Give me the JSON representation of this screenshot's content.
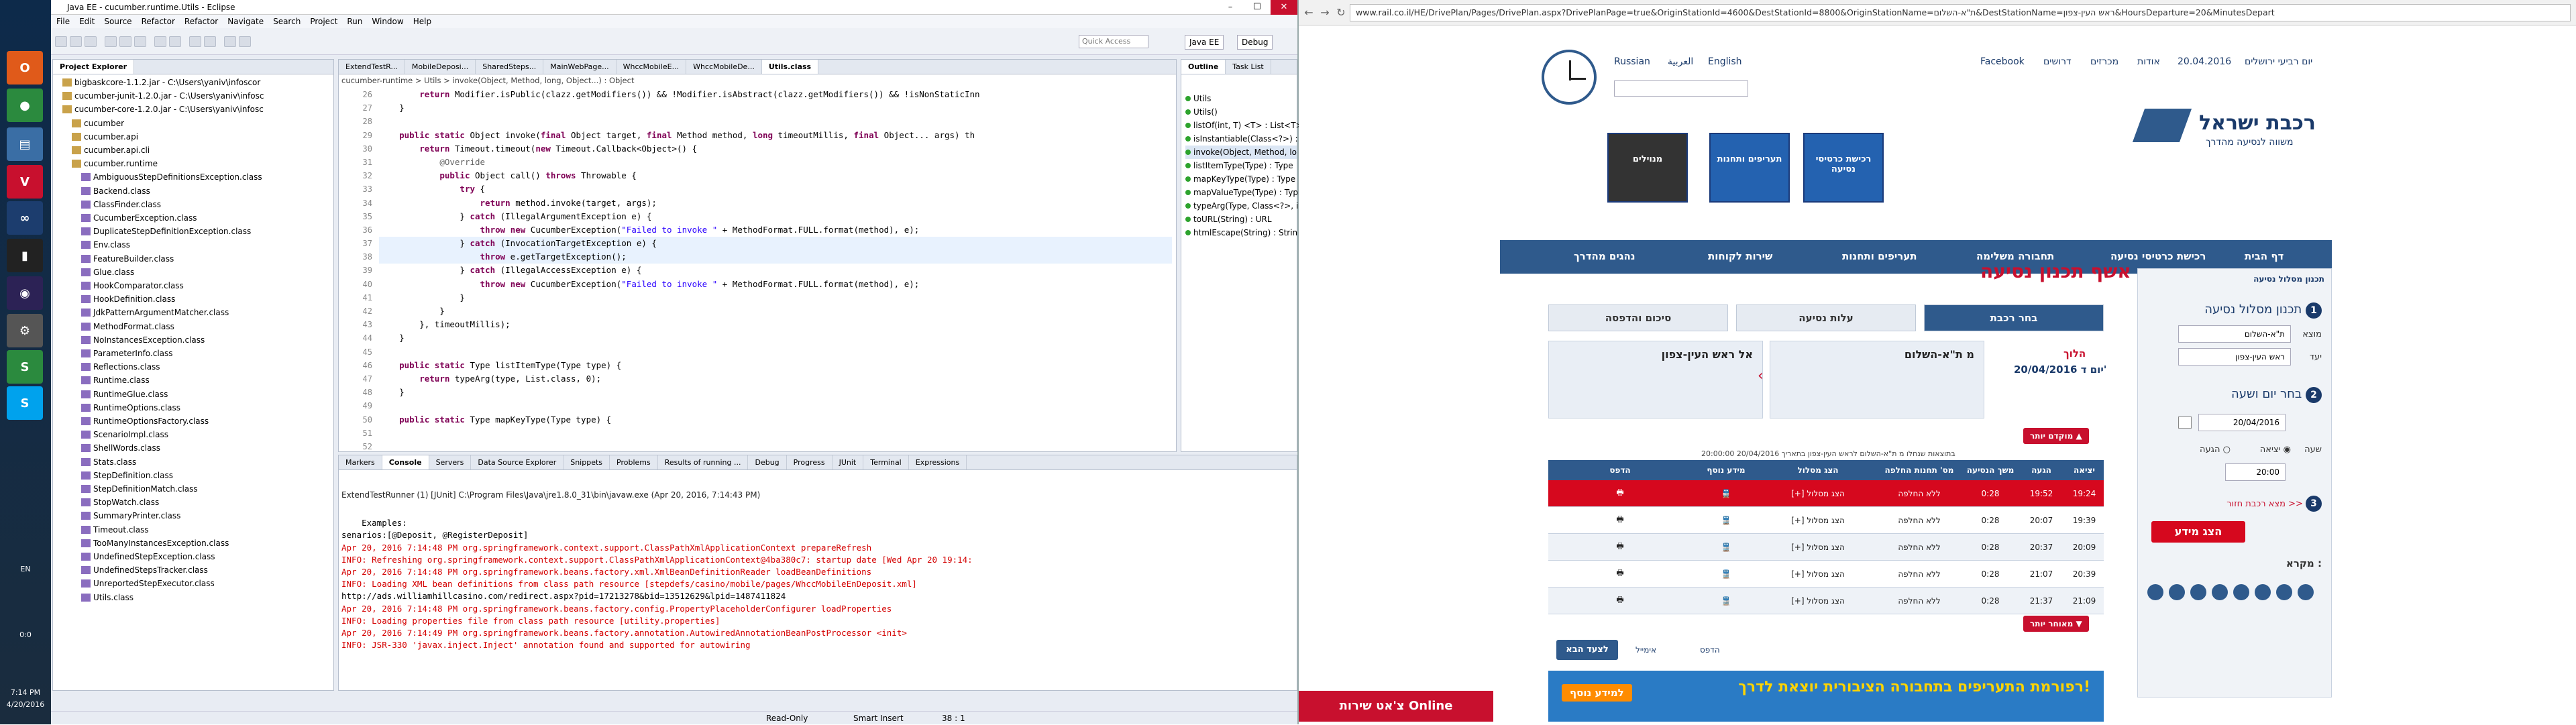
{
  "taskbar": {
    "clock_time": "7:14 PM",
    "clock_date": "4/20/2016",
    "lang": "EN",
    "counter": "0:0"
  },
  "eclipse": {
    "title": "Java EE - cucumber.runtime.Utils - Eclipse",
    "menus": [
      "File",
      "Edit",
      "Source",
      "Refactor",
      "Refactor",
      "Navigate",
      "Search",
      "Project",
      "Run",
      "Window",
      "Help"
    ],
    "quick_access": "Quick Access",
    "perspectives": [
      "Java EE",
      "Debug"
    ],
    "project_explorer_title": "Project Explorer",
    "tree": [
      {
        "label": "bigbaskcore-1.1.2.jar - C:\\Users\\yaniv\\infoscor",
        "indent": 1
      },
      {
        "label": "cucumber-junit-1.2.0.jar - C:\\Users\\yaniv\\infosc",
        "indent": 1
      },
      {
        "label": "cucumber-core-1.2.0.jar - C:\\Users\\yaniv\\infosc",
        "indent": 1
      },
      {
        "label": "cucumber",
        "indent": 2
      },
      {
        "label": "cucumber.api",
        "indent": 2
      },
      {
        "label": "cucumber.api.cli",
        "indent": 2
      },
      {
        "label": "cucumber.runtime",
        "indent": 2
      },
      {
        "label": "AmbiguousStepDefinitionsException.class",
        "indent": 3
      },
      {
        "label": "Backend.class",
        "indent": 3
      },
      {
        "label": "ClassFinder.class",
        "indent": 3
      },
      {
        "label": "CucumberException.class",
        "indent": 3
      },
      {
        "label": "DuplicateStepDefinitionException.class",
        "indent": 3
      },
      {
        "label": "Env.class",
        "indent": 3
      },
      {
        "label": "FeatureBuilder.class",
        "indent": 3
      },
      {
        "label": "Glue.class",
        "indent": 3
      },
      {
        "label": "HookComparator.class",
        "indent": 3
      },
      {
        "label": "HookDefinition.class",
        "indent": 3
      },
      {
        "label": "JdkPatternArgumentMatcher.class",
        "indent": 3
      },
      {
        "label": "MethodFormat.class",
        "indent": 3
      },
      {
        "label": "NoInstancesException.class",
        "indent": 3
      },
      {
        "label": "ParameterInfo.class",
        "indent": 3
      },
      {
        "label": "Reflections.class",
        "indent": 3
      },
      {
        "label": "Runtime.class",
        "indent": 3
      },
      {
        "label": "RuntimeGlue.class",
        "indent": 3
      },
      {
        "label": "RuntimeOptions.class",
        "indent": 3
      },
      {
        "label": "RuntimeOptionsFactory.class",
        "indent": 3
      },
      {
        "label": "ScenarioImpl.class",
        "indent": 3
      },
      {
        "label": "ShellWords.class",
        "indent": 3
      },
      {
        "label": "Stats.class",
        "indent": 3
      },
      {
        "label": "StepDefinition.class",
        "indent": 3
      },
      {
        "label": "StepDefinitionMatch.class",
        "indent": 3
      },
      {
        "label": "StopWatch.class",
        "indent": 3
      },
      {
        "label": "SummaryPrinter.class",
        "indent": 3
      },
      {
        "label": "Timeout.class",
        "indent": 3
      },
      {
        "label": "TooManyInstancesException.class",
        "indent": 3
      },
      {
        "label": "UndefinedStepException.class",
        "indent": 3
      },
      {
        "label": "UndefinedStepsTracker.class",
        "indent": 3
      },
      {
        "label": "UnreportedStepExecutor.class",
        "indent": 3
      },
      {
        "label": "Utils.class",
        "indent": 3
      }
    ],
    "editor_tabs": [
      "ExtendTestR...",
      "MobileDeposi...",
      "SharedSteps...",
      "MainWebPage...",
      "WhccMobileE...",
      "WhccMobileDe...",
      "Utils.class"
    ],
    "breadcrumb": "cucumber-runtime > Utils > invoke(Object, Method, long, Object...) : Object",
    "line_numbers": [
      "26",
      "27",
      "28",
      "29",
      "30",
      "31",
      "32",
      "33",
      "34",
      "35",
      "36",
      "37",
      "38",
      "39",
      "40",
      "41",
      "42",
      "43",
      "44",
      "45",
      "46",
      "47",
      "48",
      "49",
      "50",
      "51",
      "52"
    ],
    "code": [
      "        return Modifier.isPublic(clazz.getModifiers()) && !Modifier.isAbstract(clazz.getModifiers()) && !isNonStaticInn",
      "    }",
      "",
      "    public static Object invoke(final Object target, final Method method, long timeoutMillis, final Object... args) th",
      "        return Timeout.timeout(new Timeout.Callback<Object>() {",
      "            @Override",
      "            public Object call() throws Throwable {",
      "                try {",
      "                    return method.invoke(target, args);",
      "                } catch (IllegalArgumentException e) {",
      "                    throw new CucumberException(\"Failed to invoke \" + MethodFormat.FULL.format(method), e);",
      "                } catch (InvocationTargetException e) {",
      "                    throw e.getTargetException();",
      "                } catch (IllegalAccessException e) {",
      "                    throw new CucumberException(\"Failed to invoke \" + MethodFormat.FULL.format(method), e);",
      "                }",
      "            }",
      "        }, timeoutMillis);",
      "    }",
      "",
      "    public static Type listItemType(Type type) {",
      "        return typeArg(type, List.class, 0);",
      "    }",
      "",
      "    public static Type mapKeyType(Type type) {"
    ],
    "outline_tabs": [
      "Outline",
      "Task List"
    ],
    "outline": [
      "Utils",
      "Utils()",
      "listOf(int, T) <T> : List<T>",
      "isInstantiable(Class<?>) : b",
      "invoke(Object, Method, lo",
      "listItemType(Type) : Type",
      "mapKeyType(Type) : Type",
      "mapValueType(Type) : Typ",
      "typeArg(Type, Class<?>, int",
      "toURL(String) : URL",
      "htmlEscape(String) : Strin"
    ],
    "bottom_tabs": [
      "Markers",
      "Console",
      "Servers",
      "Data Source Explorer",
      "Snippets",
      "Problems",
      "Results of running ...",
      "Debug",
      "Progress",
      "JUnit",
      "Terminal",
      "Expressions"
    ],
    "console_title": "ExtendTestRunner (1) [JUnit] C:\\Program Files\\Java\\jre1.8.0_31\\bin\\javaw.exe (Apr 20, 2016, 7:14:43 PM)",
    "console_lines": [
      {
        "text": "",
        "red": false
      },
      {
        "text": "    Examples:",
        "red": false
      },
      {
        "text": "senarios:[@Deposit, @RegisterDeposit]",
        "red": false
      },
      {
        "text": "Apr 20, 2016 7:14:48 PM org.springframework.context.support.ClassPathXmlApplicationContext prepareRefresh",
        "red": true
      },
      {
        "text": "INFO: Refreshing org.springframework.context.support.ClassPathXmlApplicationContext@4ba380c7: startup date [Wed Apr 20 19:14:",
        "red": true
      },
      {
        "text": "Apr 20, 2016 7:14:48 PM org.springframework.beans.factory.xml.XmlBeanDefinitionReader loadBeanDefinitions",
        "red": true
      },
      {
        "text": "INFO: Loading XML bean definitions from class path resource [stepdefs/casino/mobile/pages/WhccMobileEnDeposit.xml]",
        "red": true
      },
      {
        "text": "http://ads.williamhillcasino.com/redirect.aspx?pid=17213278&bid=13512629&lpid=1487411824",
        "red": false
      },
      {
        "text": "Apr 20, 2016 7:14:48 PM org.springframework.beans.factory.config.PropertyPlaceholderConfigurer loadProperties",
        "red": true
      },
      {
        "text": "INFO: Loading properties file from class path resource [utility.properties]",
        "red": true
      },
      {
        "text": "Apr 20, 2016 7:14:49 PM org.springframework.beans.factory.annotation.AutowiredAnnotationBeanPostProcessor <init>",
        "red": true
      },
      {
        "text": "INFO: JSR-330 'javax.inject.Inject' annotation found and supported for autowiring",
        "red": true
      }
    ],
    "status": {
      "mode": "Read-Only",
      "insert": "Smart Insert",
      "pos": "38 : 1"
    }
  },
  "browser": {
    "url": "www.rail.co.il/HE/DrivePlan/Pages/DrivePlan.aspx?DrivePlanPage=true&OriginStationId=4600&DestStationId=8800&OriginStationName=ת\"א-השלום&DestStationName=ראש העין-צפון&HoursDeparture=20&MinutesDepart",
    "langs": [
      "Russian",
      "العربية",
      "English"
    ],
    "top_right_links": [
      "Facebook",
      "דרושים",
      "מכרזים",
      "אודות",
      "20.04.2016",
      "יום רביעי ירושלים"
    ],
    "promos": [
      "רכישת כרטיסי נסיעה",
      "תעריפים ותחנות",
      "מנוילים"
    ],
    "nav_items": [
      "דף הבית",
      "רכישת כרטיסי נסיעה",
      "תחבורה משלימה",
      "תעריפים ותחנות",
      "שירות לקוחות",
      "נהגים מהדרך"
    ],
    "page_title": "אשף תכנון נסיעה",
    "steps": [
      {
        "num": "1",
        "label": "בחר רכבת"
      },
      {
        "num": "2",
        "label": "עלות נסיעה"
      },
      {
        "num": "3",
        "label": "סיכום והדפסה"
      }
    ],
    "outbound_label": "הלוך",
    "outbound_date": "20/04/2016 יום ד'",
    "from_station": "מ ת\"א-השלום",
    "to_station": "אל ראש העין-צפון",
    "earlier_trains": "מוקדם יותר",
    "later_trains": "מאוחר יותר",
    "trip_note": "בתוצאות שנחלו מ ת\"א-השלום לראש העין-צפון בתאריך 20/04/2016 20:00:00",
    "table_headers": [
      "יציאה",
      "הגעה",
      "משך הנסיעה",
      "מס' תחנות החלפה",
      "הצג מסלול",
      "מידע נוסף",
      "הדפס"
    ],
    "trips": [
      {
        "dep": "19:24",
        "arr": "19:52",
        "dur": "0:28",
        "changes": "ללא החלפה",
        "route": "[+] הצג מסלול",
        "selected": true
      },
      {
        "dep": "19:39",
        "arr": "20:07",
        "dur": "0:28",
        "changes": "ללא החלפה",
        "route": "[+] הצג מסלול",
        "selected": false
      },
      {
        "dep": "20:09",
        "arr": "20:37",
        "dur": "0:28",
        "changes": "ללא החלפה",
        "route": "[+] הצג מסלול",
        "selected": false
      },
      {
        "dep": "20:39",
        "arr": "21:07",
        "dur": "0:28",
        "changes": "ללא החלפה",
        "route": "[+] הצג מסלול",
        "selected": false
      },
      {
        "dep": "21:09",
        "arr": "21:37",
        "dur": "0:28",
        "changes": "ללא החלפה",
        "route": "[+] הצג מסלול",
        "selected": false
      }
    ],
    "actions": {
      "next": "לצעד הבא",
      "print": "הדפס",
      "email": "אימייל"
    },
    "side": {
      "title": "תכנון מסלול נסיעה",
      "step1": "תכנון מסלול נסיעה",
      "from_label": "מוצא",
      "from_value": "ת\"א-השלום",
      "to_label": "יעד",
      "to_value": "ראש העין-צפון",
      "step2": "בחר יום ושעה",
      "date_value": "20/04/2016",
      "hour_label": "שעה",
      "dep_label": "יציאה",
      "arr_label": "הגעה",
      "time_value": "20:00",
      "step3": "מצא רכבת חזור >>",
      "submit": "הצג מידע",
      "legend": "מקרא :"
    },
    "chat": "צ'אט שירות Online",
    "banner": "רפורמת התעריפים בתחבורה הציבורית יוצאת לדרך!",
    "banner_btn": "למידע נוסף"
  }
}
